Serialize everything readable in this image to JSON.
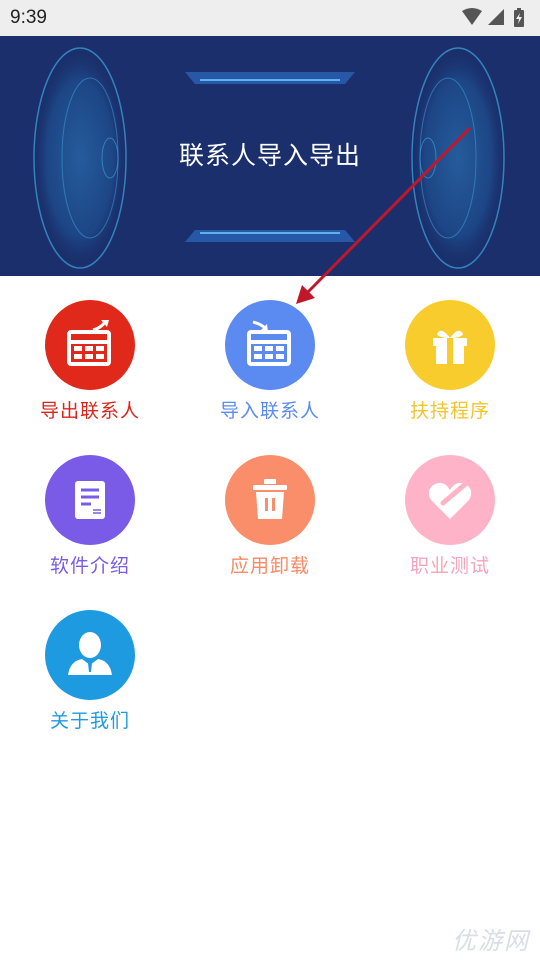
{
  "status_bar": {
    "time": "9:39"
  },
  "banner": {
    "title": "联系人导入导出"
  },
  "tiles": [
    {
      "label": "导出联系人",
      "color": "#e0291a",
      "label_color": "#d8261c",
      "icon": "export-calendar-icon"
    },
    {
      "label": "导入联系人",
      "color": "#5b8bf0",
      "label_color": "#5b8bf0",
      "icon": "import-calendar-icon"
    },
    {
      "label": "扶持程序",
      "color": "#f9cc2e",
      "label_color": "#f2c52a",
      "icon": "gift-box-icon"
    },
    {
      "label": "软件介绍",
      "color": "#7a5be8",
      "label_color": "#7a5be8",
      "icon": "document-icon"
    },
    {
      "label": "应用卸载",
      "color": "#fb8e6a",
      "label_color": "#f78a66",
      "icon": "trash-icon"
    },
    {
      "label": "职业测试",
      "color": "#ffb3c8",
      "label_color": "#f4a5bd",
      "icon": "heart-icon"
    },
    {
      "label": "关于我们",
      "color": "#1e9be0",
      "label_color": "#1e9be0",
      "icon": "user-icon"
    }
  ],
  "watermark": {
    "text": "优游网"
  }
}
